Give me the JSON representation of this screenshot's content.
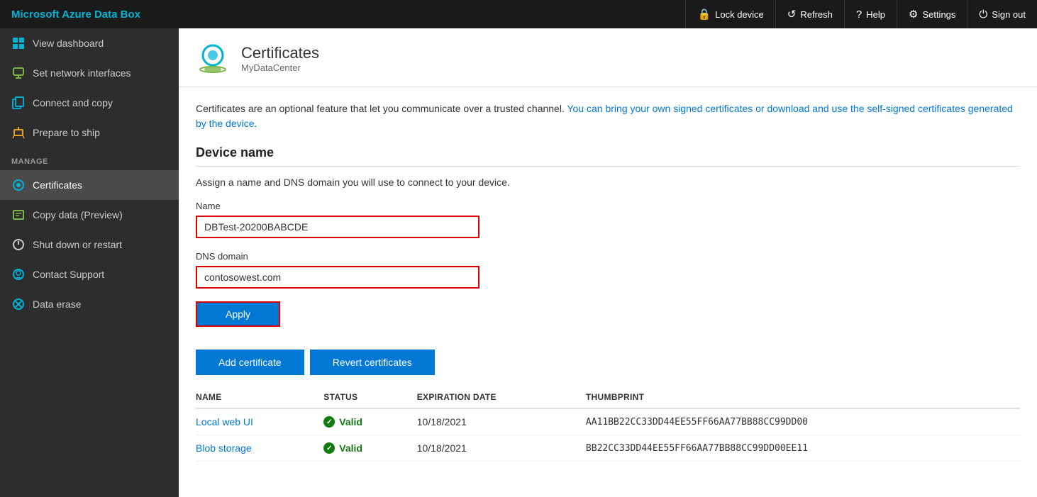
{
  "topbar": {
    "title": "Microsoft Azure Data Box",
    "actions": [
      {
        "id": "lock",
        "label": "Lock device",
        "icon": "🔒"
      },
      {
        "id": "refresh",
        "label": "Refresh",
        "icon": "↺"
      },
      {
        "id": "help",
        "label": "Help",
        "icon": "?"
      },
      {
        "id": "settings",
        "label": "Settings",
        "icon": "⚙"
      },
      {
        "id": "signout",
        "label": "Sign out",
        "icon": "⏻"
      }
    ]
  },
  "sidebar": {
    "nav_items": [
      {
        "id": "dashboard",
        "label": "View dashboard",
        "icon": "dashboard"
      },
      {
        "id": "network",
        "label": "Set network interfaces",
        "icon": "network"
      },
      {
        "id": "copy",
        "label": "Connect and copy",
        "icon": "copy"
      },
      {
        "id": "ship",
        "label": "Prepare to ship",
        "icon": "ship"
      }
    ],
    "section_label": "MANAGE",
    "manage_items": [
      {
        "id": "certificates",
        "label": "Certificates",
        "icon": "cert",
        "active": true
      },
      {
        "id": "copydata",
        "label": "Copy data (Preview)",
        "icon": "copydata"
      },
      {
        "id": "shutdown",
        "label": "Shut down or restart",
        "icon": "shutdown"
      },
      {
        "id": "support",
        "label": "Contact Support",
        "icon": "support"
      },
      {
        "id": "erase",
        "label": "Data erase",
        "icon": "erase"
      }
    ]
  },
  "page": {
    "title": "Certificates",
    "subtitle": "MyDataCenter",
    "description_part1": "Certificates are an optional feature that let you communicate over a trusted channel.",
    "description_part2": "You can bring your own signed certificates or download and use the self-signed certificates generated by the device.",
    "device_name_section": "Device name",
    "device_name_subtitle": "Assign a name and DNS domain you will use to connect to your device.",
    "name_label": "Name",
    "name_value": "DBTest-20200BABCDE",
    "dns_label": "DNS domain",
    "dns_value": "contosowest.com",
    "apply_label": "Apply",
    "add_cert_label": "Add certificate",
    "revert_cert_label": "Revert certificates",
    "table": {
      "headers": [
        "NAME",
        "STATUS",
        "EXPIRATION DATE",
        "THUMBPRINT"
      ],
      "rows": [
        {
          "name": "Local web UI",
          "status": "Valid",
          "expiration": "10/18/2021",
          "thumbprint": "AA11BB22CC33DD44EE55FF66AA77BB88CC99DD00"
        },
        {
          "name": "Blob storage",
          "status": "Valid",
          "expiration": "10/18/2021",
          "thumbprint": "BB22CC33DD44EE55FF66AA77BB88CC99DD00EE11"
        }
      ]
    }
  }
}
